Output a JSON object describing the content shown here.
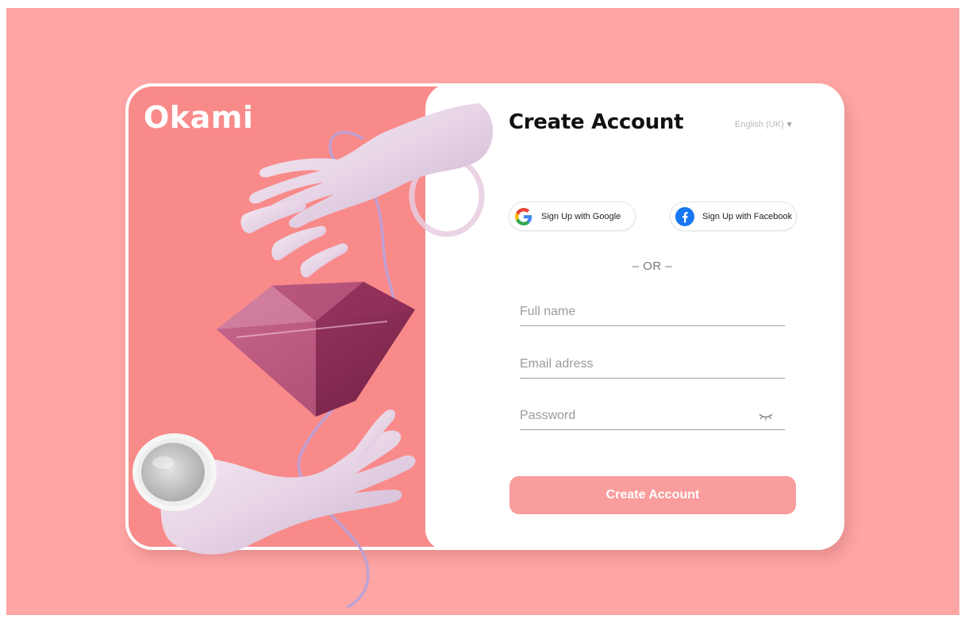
{
  "brand": {
    "logo": "Okami"
  },
  "form": {
    "title": "Create Account",
    "language": "English (UK)",
    "google_label": "Sign Up with Google",
    "facebook_label": "Sign Up with Facebook",
    "divider": "– OR –",
    "full_name_placeholder": "Full name",
    "email_placeholder": "Email adress",
    "password_placeholder": "Password",
    "submit_label": "Create Account"
  },
  "icons": {
    "google": "google-icon",
    "facebook": "facebook-icon",
    "password_toggle": "eye-closed-icon",
    "language_caret": "caret-down-icon"
  },
  "colors": {
    "background": "#fea5a5",
    "panel": "#f98a8a",
    "button": "#f99d9d",
    "facebook": "#1877f2"
  }
}
